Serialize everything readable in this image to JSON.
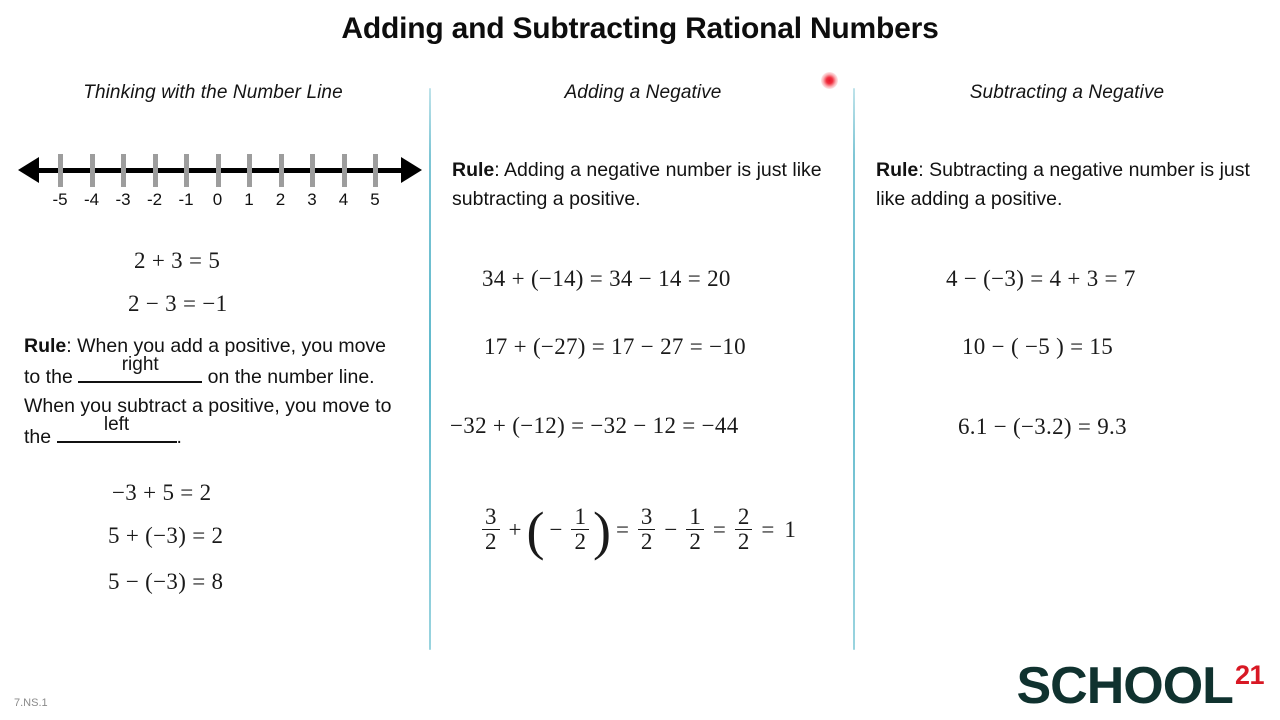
{
  "slide": {
    "title": "Adding and Subtracting Rational Numbers",
    "standard_code": "7.NS.1"
  },
  "pointer": {
    "name": "laser-dot",
    "color": "#e8152a"
  },
  "dividers": {
    "color": "#5fb9cc"
  },
  "columns": [
    {
      "header": "Thinking with the Number Line",
      "number_line": {
        "labels": [
          "-5",
          "-4",
          "-3",
          "-2",
          "-1",
          "0",
          "1",
          "2",
          "3",
          "4",
          "5"
        ],
        "min": -5,
        "max": 5,
        "tick_color": "#9d9d9d",
        "axis_color": "#000000"
      },
      "equations_top": [
        "2 + 3 =  5",
        "2 − 3 = −1"
      ],
      "rule": {
        "label": "Rule",
        "part1": ": When you add a positive, you move to the ",
        "blank1_answer": "right",
        "part2": " on the number line.  When you subtract a positive, you move to the ",
        "blank2_answer": "left",
        "part3": "."
      },
      "equations_bottom": [
        "−3 + 5 =  2",
        "5 + (−3) =  2",
        "5 − (−3) =  8"
      ]
    },
    {
      "header": "Adding a Negative",
      "rule": {
        "label": "Rule",
        "text": ": Adding a negative number is just like subtracting a positive."
      },
      "equations": [
        "34 + (−14) = 34 − 14 = 20",
        "17 + (−27) = 17 − 27 =  −10",
        "−32 + (−12) =  −32 − 12 = −44"
      ],
      "fraction_equation": {
        "terms": [
          {
            "type": "fraction",
            "num": "3",
            "den": "2"
          },
          {
            "type": "op",
            "text": "+"
          },
          {
            "type": "open_paren"
          },
          {
            "type": "op",
            "text": "−"
          },
          {
            "type": "fraction",
            "num": "1",
            "den": "2"
          },
          {
            "type": "close_paren"
          },
          {
            "type": "op",
            "text": "="
          },
          {
            "type": "fraction",
            "num": "3",
            "den": "2"
          },
          {
            "type": "op",
            "text": "−"
          },
          {
            "type": "fraction",
            "num": "1",
            "den": "2"
          },
          {
            "type": "op",
            "text": "="
          },
          {
            "type": "fraction",
            "num": "2",
            "den": "2"
          },
          {
            "type": "op",
            "text": "="
          },
          {
            "type": "value",
            "text": "1"
          }
        ],
        "plain": "3/2 + (−1/2) = 3/2 − 1/2 = 2/2 = 1"
      }
    },
    {
      "header": "Subtracting a Negative",
      "rule": {
        "label": "Rule",
        "text": ": Subtracting a negative number is just like adding a positive."
      },
      "equations": [
        "4 − (−3) = 4 + 3 = 7",
        "10 − (  −5 ) = 15",
        "6.1 − (−3.2) = 9.3"
      ]
    }
  ],
  "logo": {
    "word": "SCHOOL",
    "superscript": "21",
    "word_color": "#10322f",
    "superscript_color": "#d81824"
  }
}
